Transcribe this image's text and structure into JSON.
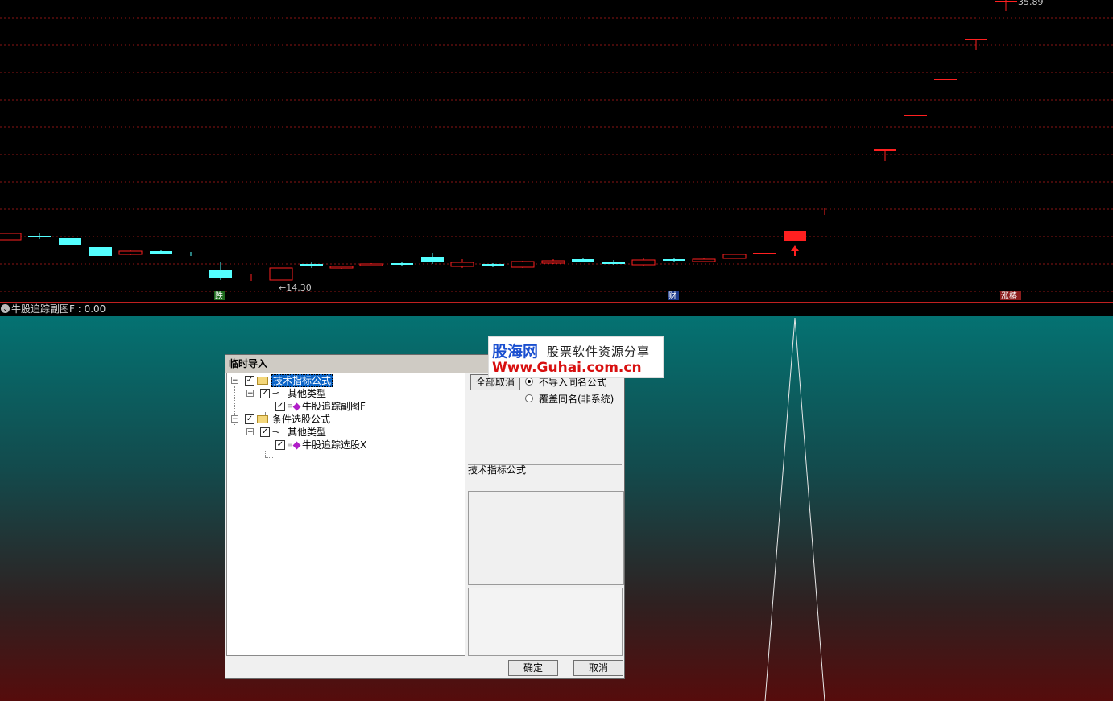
{
  "chart": {
    "price_high_label": "35.89",
    "price_low_label": "←14.30",
    "markers": [
      "跌",
      "财",
      "涨椿"
    ],
    "up_color": "#ff2020",
    "down_color": "#54ffff",
    "grid_color": "#8a1414"
  },
  "indicator": {
    "label": "牛股追踪副图F : 0.00"
  },
  "dialog": {
    "title": "临时导入",
    "tree": [
      {
        "label": "技术指标公式",
        "checked": true,
        "selected": true
      },
      {
        "label": "其他类型",
        "checked": true
      },
      {
        "label": "牛股追踪副图F",
        "checked": true
      },
      {
        "label": "条件选股公式",
        "checked": true
      },
      {
        "label": "其他类型",
        "checked": true
      },
      {
        "label": "牛股追踪选股X",
        "checked": true
      }
    ],
    "deselect_all_button": "全部取消",
    "options": {
      "no_import_same_name": "不导入同名公式",
      "overwrite_same_name": "覆盖同名(非系统)"
    },
    "section_label": "技术指标公式",
    "ok_button": "确定",
    "cancel_button": "取消"
  },
  "watermark": {
    "brand": "股海网",
    "slogan": "股票软件资源分享",
    "url": "Www.Guhai.com.cn"
  }
}
